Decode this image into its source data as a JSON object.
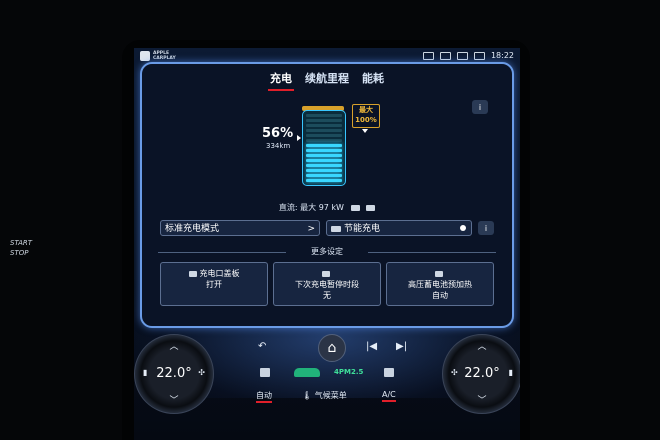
{
  "outer": {
    "start_stop": [
      "START",
      "STOP"
    ]
  },
  "status": {
    "carplay": [
      "APPLE",
      "CARPLAY"
    ],
    "time": "18:22"
  },
  "tabs": [
    {
      "label": "充电",
      "active": true
    },
    {
      "label": "续航里程",
      "active": false
    },
    {
      "label": "能耗",
      "active": false
    }
  ],
  "battery": {
    "percent": "56%",
    "range": "334km",
    "charge_level": 0.56,
    "limit_label": "最大",
    "limit_value": "100%"
  },
  "dc": {
    "text": "直流: 最大 97 kW"
  },
  "mode": {
    "label": "标准充电模式",
    "chevron": ">"
  },
  "eco": {
    "label": "节能充电"
  },
  "more_settings": "更多设定",
  "cards": [
    {
      "title": "充电口盖板",
      "value": "打开",
      "icon": "charge-port-icon"
    },
    {
      "title": "下次充电暂停时段",
      "value": "无",
      "icon": "clock-icon"
    },
    {
      "title": "高压蓄电池预加热",
      "value": "自动",
      "icon": "battery-heat-icon"
    }
  ],
  "climate": {
    "left_temp": "22.0°",
    "right_temp": "22.0°",
    "auto": "自动",
    "menu": "气候菜单",
    "ac": "A/C",
    "pm": "PM2.5",
    "pm_prefix": "4"
  },
  "colors": {
    "accent": "#6a9be6",
    "underline": "#e01f2a",
    "battery": "#3ad8ff",
    "limit": "#d8a12b"
  }
}
